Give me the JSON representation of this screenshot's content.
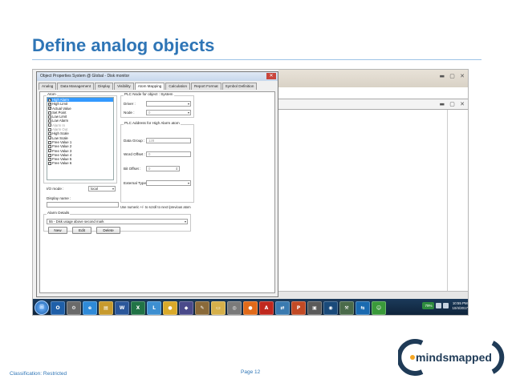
{
  "slide": {
    "title": "Define analog objects",
    "classification": "Classification: Restricted",
    "page": "Page 12",
    "logo_text": "mindsmapped"
  },
  "dialog": {
    "title": "Object Properties System @ Global - Disk monitor",
    "tabs": [
      {
        "label": "Analog",
        "active": false
      },
      {
        "label": "Data Management",
        "active": false
      },
      {
        "label": "Display",
        "active": false
      },
      {
        "label": "Visibility",
        "active": false
      },
      {
        "label": "Atom Mapping",
        "active": true
      },
      {
        "label": "Calculation",
        "active": false
      },
      {
        "label": "Report Format",
        "active": false
      },
      {
        "label": "Symbol Definition",
        "active": false
      }
    ],
    "atom_group_label": "Atom",
    "atoms": [
      {
        "label": "High Alarm",
        "checked": true,
        "selected": true,
        "disabled": false
      },
      {
        "label": "High Limit",
        "checked": true,
        "selected": false,
        "disabled": false
      },
      {
        "label": "Actual Value",
        "checked": true,
        "selected": false,
        "disabled": false
      },
      {
        "label": "Set Point",
        "checked": false,
        "selected": false,
        "disabled": false
      },
      {
        "label": "Low Limit",
        "checked": false,
        "selected": false,
        "disabled": false
      },
      {
        "label": "Low Alarm",
        "checked": false,
        "selected": false,
        "disabled": false
      },
      {
        "label": "Alarm In",
        "checked": false,
        "selected": false,
        "disabled": true
      },
      {
        "label": "Alarm Out",
        "checked": false,
        "selected": false,
        "disabled": true
      },
      {
        "label": "High Scale",
        "checked": false,
        "selected": false,
        "disabled": false
      },
      {
        "label": "Low Scale",
        "checked": false,
        "selected": false,
        "disabled": false
      },
      {
        "label": "Free Value 1",
        "checked": false,
        "selected": false,
        "disabled": false
      },
      {
        "label": "Free Value 2",
        "checked": false,
        "selected": false,
        "disabled": false
      },
      {
        "label": "Free Value 3",
        "checked": false,
        "selected": false,
        "disabled": false
      },
      {
        "label": "Free Value 4",
        "checked": false,
        "selected": false,
        "disabled": false
      },
      {
        "label": "Free Value 5",
        "checked": false,
        "selected": false,
        "disabled": false
      },
      {
        "label": "Free Value 6",
        "checked": false,
        "selected": false,
        "disabled": false
      }
    ],
    "io_mode_label": "I/O mode :",
    "io_mode_value": "local",
    "display_name_label": "Display name :",
    "alarm_details_label": "Alarm Details",
    "alarm_details_value": "55 - Disk usage above second mark",
    "buttons": {
      "new": "New",
      "edit": "Edit",
      "delete": "Delete"
    },
    "plc_node_group": "PLC Node for object : System",
    "driver_label": "Driver :",
    "node_label": "Node :",
    "node_value": "0",
    "plc_address_group": "PLC Address for High Alarm atom",
    "data_group_label": "Data Group :",
    "data_group_value": "128",
    "word_offset_label": "Word Offset :",
    "word_offset_value": "0",
    "bit_offset_label": "Bit Offset :",
    "bit_offset_value": "0",
    "external_type_label": "External Type :",
    "hint": "Use numeric +/- to scroll to next /previous atom"
  },
  "taskbar": {
    "icons": [
      {
        "name": "outlook-icon",
        "glyph": "O",
        "color": "#1f5fa8"
      },
      {
        "name": "tools-icon",
        "glyph": "⚙",
        "color": "#6a6a6a"
      },
      {
        "name": "ie-icon",
        "glyph": "e",
        "color": "#2f8ad8"
      },
      {
        "name": "explorer-icon",
        "glyph": "▤",
        "color": "#c79a2e"
      },
      {
        "name": "word-icon",
        "glyph": "W",
        "color": "#2b579a"
      },
      {
        "name": "excel-icon",
        "glyph": "X",
        "color": "#217346"
      },
      {
        "name": "lync-icon",
        "glyph": "L",
        "color": "#3d8fd1"
      },
      {
        "name": "chrome-icon",
        "glyph": "●",
        "color": "#d9a92a"
      },
      {
        "name": "media-icon",
        "glyph": "◆",
        "color": "#4a4a8a"
      },
      {
        "name": "paint-icon",
        "glyph": "✎",
        "color": "#8a6a3a"
      },
      {
        "name": "folder-icon",
        "glyph": "▭",
        "color": "#d6b04a"
      },
      {
        "name": "app-icon",
        "glyph": "◎",
        "color": "#7a7a7a"
      },
      {
        "name": "firefox-icon",
        "glyph": "●",
        "color": "#e06a1a"
      },
      {
        "name": "acrobat-icon",
        "glyph": "A",
        "color": "#c0281e"
      },
      {
        "name": "network-icon",
        "glyph": "⇄",
        "color": "#3a7ab0"
      },
      {
        "name": "powerpoint-icon",
        "glyph": "P",
        "color": "#c24a25"
      },
      {
        "name": "monitor-icon",
        "glyph": "▣",
        "color": "#5a5a5a"
      },
      {
        "name": "viewer-icon",
        "glyph": "◉",
        "color": "#1a4a7a"
      },
      {
        "name": "settings-icon",
        "glyph": "⚒",
        "color": "#4a6a4a"
      },
      {
        "name": "teamviewer-icon",
        "glyph": "⇆",
        "color": "#1a6ab0"
      },
      {
        "name": "user-icon",
        "glyph": "☺",
        "color": "#3a9a3a"
      }
    ],
    "battery": "79%",
    "time": "10:55 PM",
    "date": "10/4/2017"
  }
}
